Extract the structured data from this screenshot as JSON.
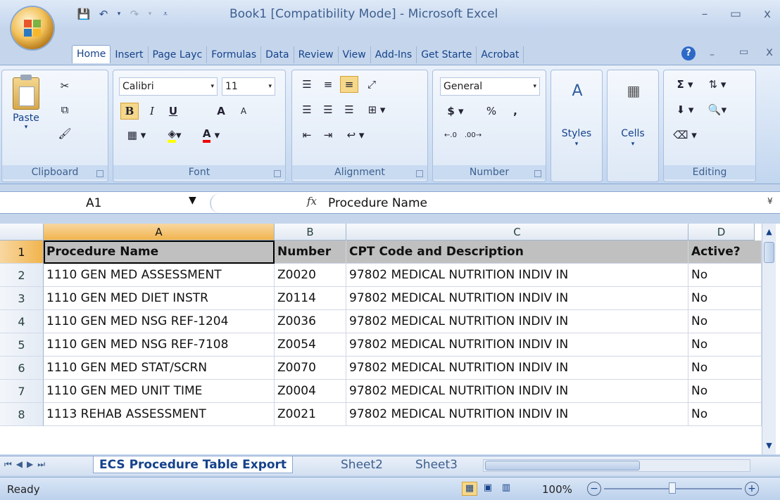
{
  "app": {
    "window_title": "Book1 [Compatibility Mode] - Microsoft Excel"
  },
  "qat": {
    "undo_icon": "undo-icon",
    "redo_icon": "redo-icon",
    "save_icon": "save-icon"
  },
  "ribbon": {
    "tabs": [
      "Home",
      "Insert",
      "Page Layc",
      "Formulas",
      "Data",
      "Review",
      "View",
      "Add-Ins",
      "Get Starte",
      "Acrobat"
    ],
    "clipboard": {
      "label": "Clipboard",
      "paste": "Paste"
    },
    "font": {
      "label": "Font",
      "name": "Calibri",
      "size": "11",
      "bold": "B",
      "italic": "I",
      "underline": "U",
      "grow": "A",
      "shrink": "A",
      "fontcolor": "A"
    },
    "alignment": {
      "label": "Alignment"
    },
    "number": {
      "label": "Number",
      "format": "General",
      "currency": "$",
      "percent": "%",
      "comma": ","
    },
    "styles": {
      "label": "Styles"
    },
    "cells": {
      "label": "Cells"
    },
    "editing": {
      "label": "Editing",
      "sum": "Σ"
    }
  },
  "formula_bar": {
    "name_box": "A1",
    "fx": "fx",
    "value": "Procedure Name"
  },
  "columns": [
    "A",
    "B",
    "C",
    "D"
  ],
  "rows": [
    {
      "n": "1",
      "a": "Procedure Name",
      "b": "Number",
      "c": "CPT Code and Description",
      "d": "Active?"
    },
    {
      "n": "2",
      "a": "1110 GEN MED ASSESSMENT",
      "b": "Z0020",
      "c": "97802  MEDICAL NUTRITION INDIV IN",
      "d": "No"
    },
    {
      "n": "3",
      "a": "1110 GEN MED DIET INSTR",
      "b": "Z0114",
      "c": "97802  MEDICAL NUTRITION INDIV IN",
      "d": "No"
    },
    {
      "n": "4",
      "a": "1110 GEN MED NSG REF-1204",
      "b": "Z0036",
      "c": "97802  MEDICAL NUTRITION INDIV IN",
      "d": "No"
    },
    {
      "n": "5",
      "a": "1110 GEN MED NSG REF-7108",
      "b": "Z0054",
      "c": "97802  MEDICAL NUTRITION INDIV IN",
      "d": "No"
    },
    {
      "n": "6",
      "a": "1110 GEN MED STAT/SCRN",
      "b": "Z0070",
      "c": "97802  MEDICAL NUTRITION INDIV IN",
      "d": "No"
    },
    {
      "n": "7",
      "a": "1110 GEN MED UNIT TIME",
      "b": "Z0004",
      "c": "97802  MEDICAL NUTRITION INDIV IN",
      "d": "No"
    },
    {
      "n": "8",
      "a": "1113 REHAB ASSESSMENT",
      "b": "Z0021",
      "c": "97802  MEDICAL NUTRITION INDIV IN",
      "d": "No"
    }
  ],
  "sheets": {
    "active": "ECS Procedure Table Export",
    "s2": "Sheet2",
    "s3": "Sheet3"
  },
  "status": {
    "ready": "Ready",
    "zoom": "100%"
  }
}
